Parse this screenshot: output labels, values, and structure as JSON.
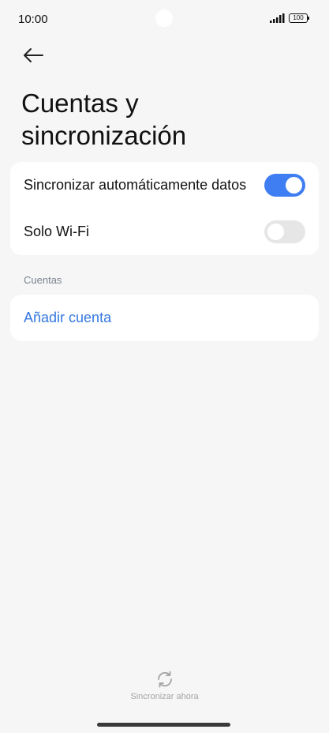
{
  "status_bar": {
    "time": "10:00",
    "battery": "100"
  },
  "header": {
    "title": "Cuentas y sincronización"
  },
  "sync_settings": {
    "items": [
      {
        "label": "Sincronizar automáticamente datos",
        "enabled": true
      },
      {
        "label": "Solo Wi-Fi",
        "enabled": false
      }
    ]
  },
  "accounts": {
    "section_label": "Cuentas",
    "add_account_label": "Añadir cuenta"
  },
  "footer": {
    "sync_now_label": "Sincronizar ahora"
  },
  "colors": {
    "accent": "#3f7ef2",
    "link": "#3478e0",
    "background": "#f6f6f6"
  }
}
